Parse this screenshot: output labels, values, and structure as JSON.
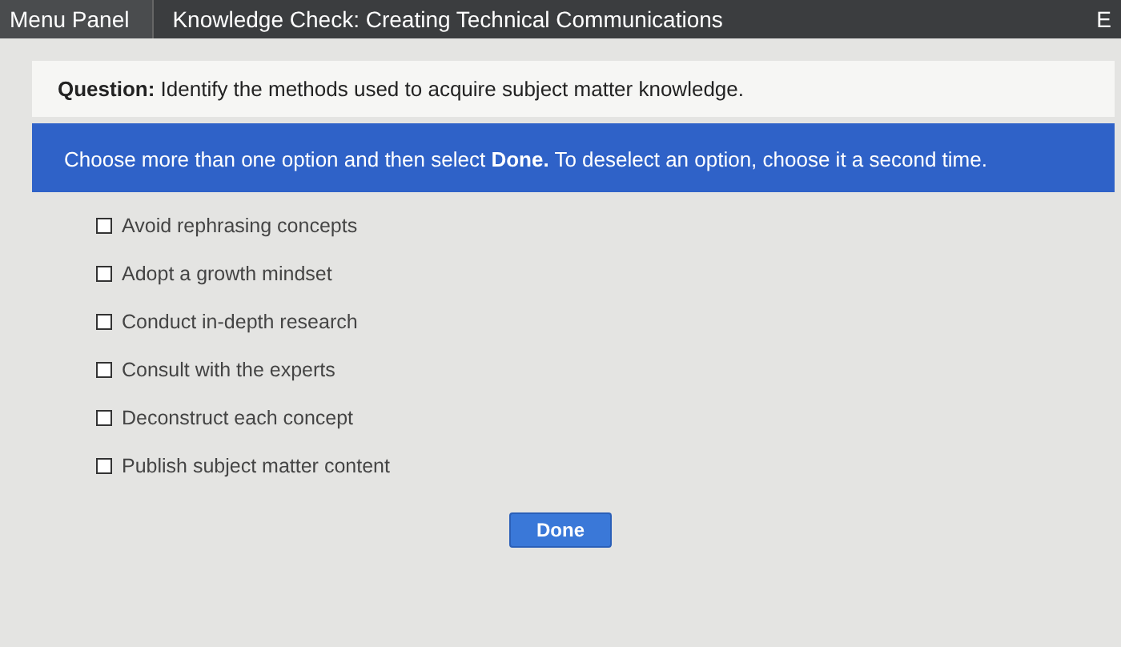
{
  "top_bar": {
    "menu_button": "Menu Panel",
    "title": "Knowledge Check: Creating Technical Communications",
    "exit_button": "E"
  },
  "question": "**Question:** Identify the methods used to acquire subject matter knowledge.",
  "instructions": "Choose more than one option and then select **Done.** To deselect an option, choose it a second time.",
  "options": [
    {
      "label": "Avoid rephrasing concepts",
      "checked": false
    },
    {
      "label": "Adopt a growth mindset",
      "checked": false
    },
    {
      "label": "Conduct in-depth research",
      "checked": false
    },
    {
      "label": "Consult with the experts",
      "checked": false
    },
    {
      "label": "Deconstruct each concept",
      "checked": false
    },
    {
      "label": "Publish subject matter content",
      "checked": false
    }
  ],
  "done_button": "Done"
}
